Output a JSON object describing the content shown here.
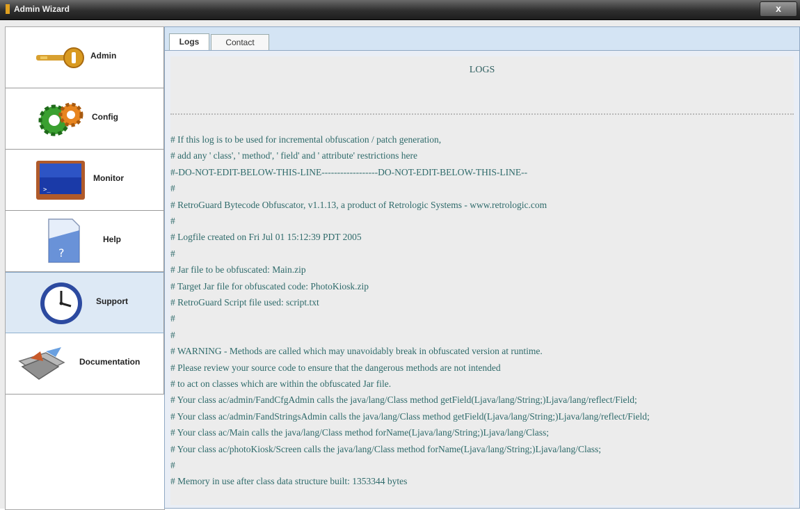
{
  "window": {
    "title": "Admin Wizard",
    "close_label": "x"
  },
  "sidebar": {
    "items": [
      {
        "label": "Admin",
        "icon": "key-icon"
      },
      {
        "label": "Config",
        "icon": "gears-icon"
      },
      {
        "label": "Monitor",
        "icon": "monitor-icon"
      },
      {
        "label": "Help",
        "icon": "help-document-icon"
      },
      {
        "label": "Support",
        "icon": "clock-icon"
      },
      {
        "label": "Documentation",
        "icon": "documentation-icon"
      }
    ],
    "active_index": 4
  },
  "tabs": [
    {
      "label": "Logs",
      "active": true
    },
    {
      "label": "Contact",
      "active": false
    }
  ],
  "log": {
    "heading": "LOGS",
    "lines": [
      "# If this log is to be used for incremental obfuscation / patch generation,",
      "# add any ' class', ' method', ' field' and ' attribute' restrictions here",
      "#-DO-NOT-EDIT-BELOW-THIS-LINE------------------DO-NOT-EDIT-BELOW-THIS-LINE--",
      "#",
      "# RetroGuard Bytecode Obfuscator, v1.1.13, a product of Retrologic Systems - www.retrologic.com",
      "#",
      "# Logfile created on Fri Jul 01 15:12:39 PDT 2005",
      "#",
      "# Jar file to be obfuscated: Main.zip",
      "# Target Jar file for obfuscated code: PhotoKiosk.zip",
      "# RetroGuard Script file used: script.txt",
      "#",
      "#",
      "# WARNING - Methods are called which may unavoidably break in obfuscated version at runtime.",
      "# Please review your source code to ensure that the dangerous methods are not intended",
      "# to act on classes which are within the obfuscated Jar file.",
      "# Your class ac/admin/FandCfgAdmin calls the java/lang/Class method getField(Ljava/lang/String;)Ljava/lang/reflect/Field;",
      "# Your class ac/admin/FandStringsAdmin calls the java/lang/Class method getField(Ljava/lang/String;)Ljava/lang/reflect/Field;",
      "# Your class ac/Main calls the java/lang/Class method forName(Ljava/lang/String;)Ljava/lang/Class;",
      "# Your class ac/photoKiosk/Screen calls the java/lang/Class method forName(Ljava/lang/String;)Ljava/lang/Class;",
      "#",
      "# Memory in use after class data structure built: 1353344 bytes"
    ]
  },
  "colors": {
    "log_text": "#2e6a6a",
    "tab_bar": "#d4e4f4",
    "selected_nav": "#dde9f5",
    "title_bar": "#2e2e2e"
  }
}
